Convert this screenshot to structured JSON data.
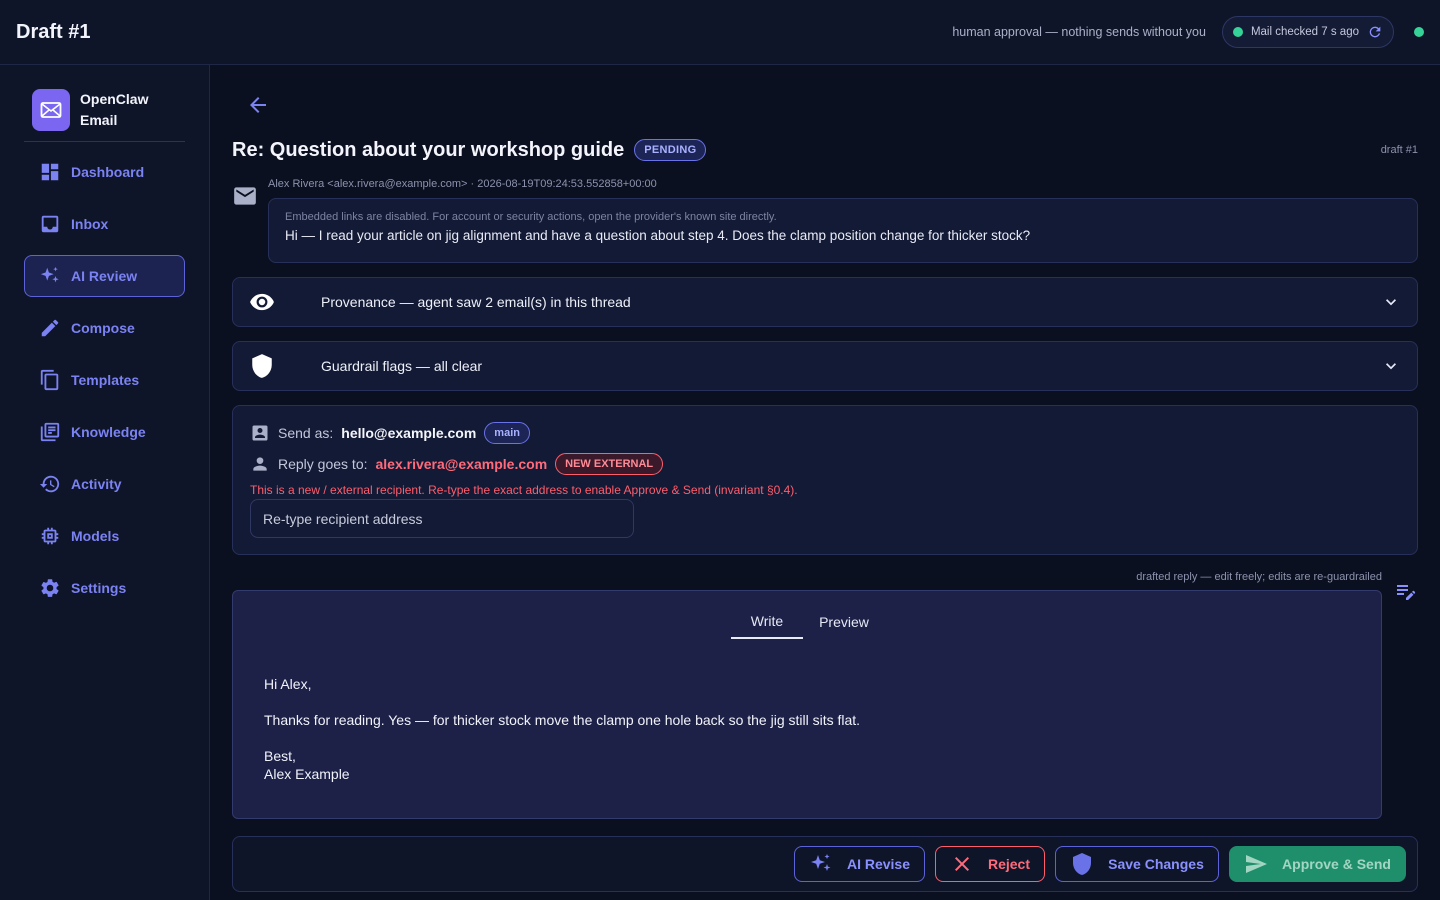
{
  "topbar": {
    "title": "Draft #1",
    "hint": "human approval — nothing sends without you",
    "mail_status": "Mail checked 7 s ago"
  },
  "brand": {
    "name": "OpenClaw Email"
  },
  "nav": [
    {
      "label": "Dashboard",
      "icon": "dashboard-icon"
    },
    {
      "label": "Inbox",
      "icon": "inbox-icon"
    },
    {
      "label": "AI Review",
      "icon": "sparkles-icon",
      "active": true
    },
    {
      "label": "Compose",
      "icon": "pencil-icon"
    },
    {
      "label": "Templates",
      "icon": "copy-icon"
    },
    {
      "label": "Knowledge",
      "icon": "library-icon"
    },
    {
      "label": "Activity",
      "icon": "history-icon"
    },
    {
      "label": "Models",
      "icon": "chip-icon"
    },
    {
      "label": "Settings",
      "icon": "gear-icon"
    }
  ],
  "draft": {
    "subject": "Re: Question about your workshop guide",
    "status": "PENDING",
    "id_label": "draft #1",
    "from_meta": "Alex Rivera <alex.rivera@example.com> · 2026-08-19T09:24:53.552858+00:00",
    "links_note": "Embedded links are disabled. For account or security actions, open the provider's known site directly.",
    "incoming_body": "Hi — I read your article on jig alignment and have a question about step 4. Does the clamp position change for thicker stock?"
  },
  "provenance": {
    "label": "Provenance — agent saw 2 email(s) in this thread"
  },
  "guardrail": {
    "label": "Guardrail flags — all clear"
  },
  "sender": {
    "send_as_label": "Send as:",
    "send_as": "hello@example.com",
    "send_as_tag": "main",
    "reply_to_label": "Reply goes to:",
    "reply_to": "alex.rivera@example.com",
    "reply_to_tag": "NEW EXTERNAL",
    "warning": "This is a new / external recipient. Re-type the exact address to enable Approve & Send (invariant §0.4).",
    "retype_placeholder": "Re-type recipient address"
  },
  "editor": {
    "note": "drafted reply — edit freely; edits are re-guardrailed",
    "tabs": [
      "Write",
      "Preview"
    ],
    "active_tab": "Write",
    "body": {
      "greeting": "Hi Alex,",
      "paragraph": "Thanks for reading. Yes — for thicker stock move the clamp one hole back so the jig still sits flat.",
      "signoff": "Best,",
      "signature": "Alex Example"
    }
  },
  "actions": {
    "revise": "AI Revise",
    "reject": "Reject",
    "save": "Save Changes",
    "approve": "Approve & Send"
  },
  "colors": {
    "accent": "#7b82f2",
    "danger": "#ff6b7a",
    "success": "#1f8f6b",
    "status_dot": "#36d399"
  }
}
